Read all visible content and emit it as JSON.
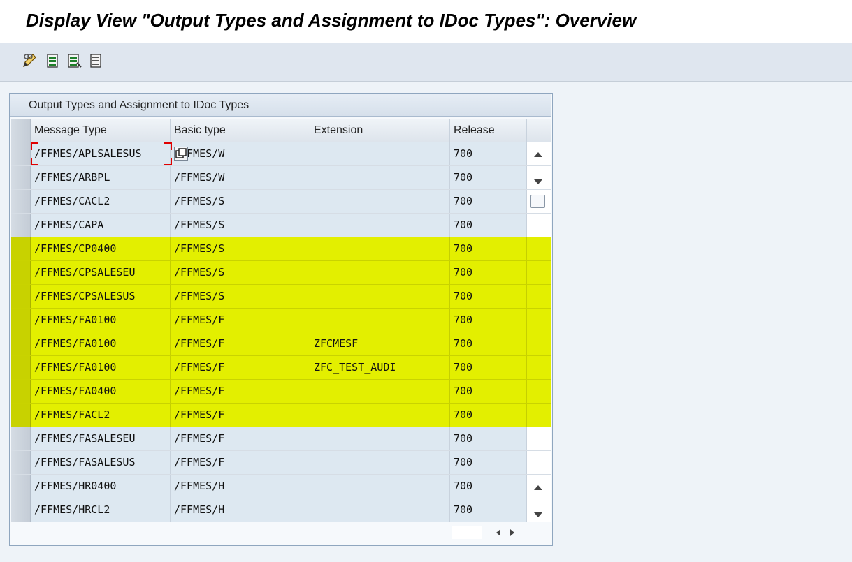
{
  "window": {
    "title": "Display View \"Output Types and Assignment to IDoc Types\": Overview"
  },
  "toolbar": {
    "buttons": [
      {
        "name": "display-change-icon"
      },
      {
        "name": "select-all-icon"
      },
      {
        "name": "select-block-icon"
      },
      {
        "name": "deselect-all-icon"
      }
    ]
  },
  "table": {
    "title": "Output Types and Assignment to IDoc Types",
    "columns": [
      "Message Type",
      "Basic type",
      "Extension",
      "Release"
    ],
    "rows": [
      {
        "message_type": "/FFMES/APLSALESUS",
        "basic_type": "/FFMES/W",
        "extension": "",
        "release": "700",
        "highlighted": false
      },
      {
        "message_type": "/FFMES/ARBPL",
        "basic_type": "/FFMES/W",
        "extension": "",
        "release": "700",
        "highlighted": false
      },
      {
        "message_type": "/FFMES/CACL2",
        "basic_type": "/FFMES/S",
        "extension": "",
        "release": "700",
        "highlighted": false
      },
      {
        "message_type": "/FFMES/CAPA",
        "basic_type": "/FFMES/S",
        "extension": "",
        "release": "700",
        "highlighted": false
      },
      {
        "message_type": "/FFMES/CP0400",
        "basic_type": "/FFMES/S",
        "extension": "",
        "release": "700",
        "highlighted": true
      },
      {
        "message_type": "/FFMES/CPSALESEU",
        "basic_type": "/FFMES/S",
        "extension": "",
        "release": "700",
        "highlighted": true
      },
      {
        "message_type": "/FFMES/CPSALESUS",
        "basic_type": "/FFMES/S",
        "extension": "",
        "release": "700",
        "highlighted": true
      },
      {
        "message_type": "/FFMES/FA0100",
        "basic_type": "/FFMES/F",
        "extension": "",
        "release": "700",
        "highlighted": true
      },
      {
        "message_type": "/FFMES/FA0100",
        "basic_type": "/FFMES/F",
        "extension": "ZFCMESF",
        "release": "700",
        "highlighted": true
      },
      {
        "message_type": "/FFMES/FA0100",
        "basic_type": "/FFMES/F",
        "extension": "ZFC_TEST_AUDI",
        "release": "700",
        "highlighted": true
      },
      {
        "message_type": "/FFMES/FA0400",
        "basic_type": "/FFMES/F",
        "extension": "",
        "release": "700",
        "highlighted": true
      },
      {
        "message_type": "/FFMES/FACL2",
        "basic_type": "/FFMES/F",
        "extension": "",
        "release": "700",
        "highlighted": true
      },
      {
        "message_type": "/FFMES/FASALESEU",
        "basic_type": "/FFMES/F",
        "extension": "",
        "release": "700",
        "highlighted": false
      },
      {
        "message_type": "/FFMES/FASALESUS",
        "basic_type": "/FFMES/F",
        "extension": "",
        "release": "700",
        "highlighted": false
      },
      {
        "message_type": "/FFMES/HR0400",
        "basic_type": "/FFMES/H",
        "extension": "",
        "release": "700",
        "highlighted": false
      },
      {
        "message_type": "/FFMES/HRCL2",
        "basic_type": "/FFMES/H",
        "extension": "",
        "release": "700",
        "highlighted": false
      }
    ]
  },
  "colors": {
    "highlight": "#e3ef00",
    "row_bg": "#dde8f1",
    "focus_marker": "#e00000"
  }
}
